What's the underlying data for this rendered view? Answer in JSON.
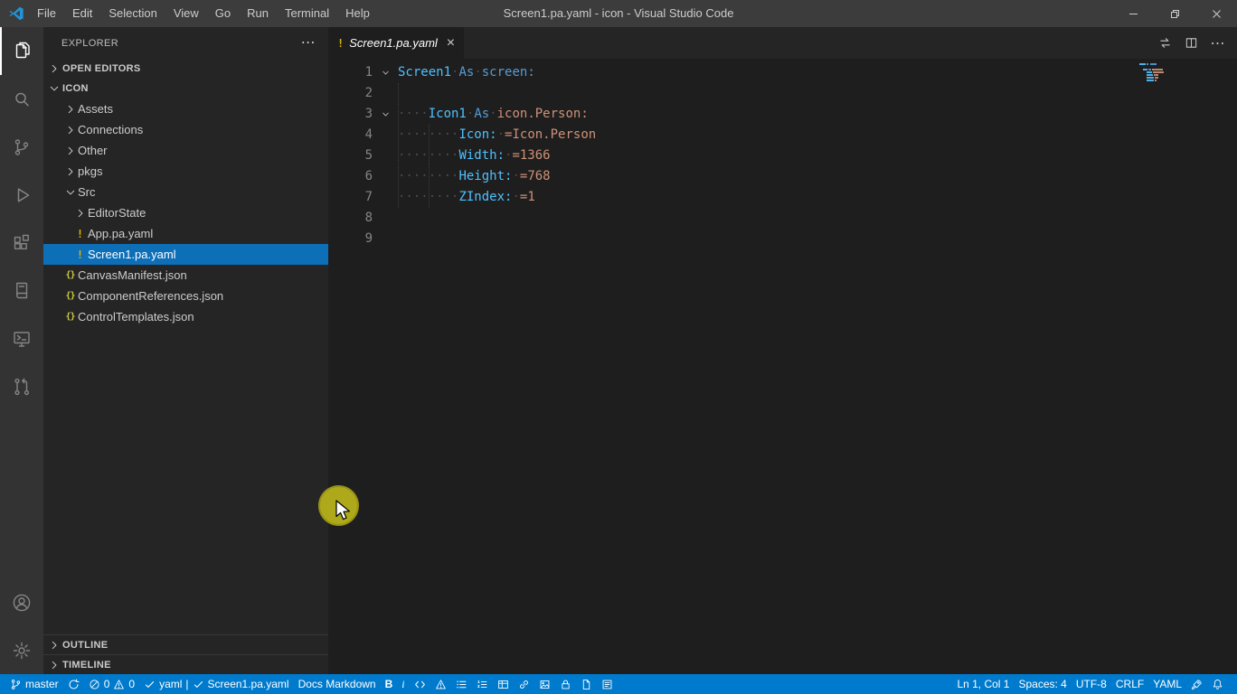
{
  "colors": {
    "accent": "#007acc",
    "titlebar": "#3c3c3c",
    "activitybar": "#333333",
    "sidebar": "#252526",
    "editor": "#1e1e1e",
    "selection": "#0d6fb8",
    "warn_icon": "#ddb100",
    "json_icon": "#cbcb41",
    "click_highlight": "#b6b01b",
    "syntax": {
      "name": "#4fc1ff",
      "keyword": "#569cd6",
      "property": "#4fc1ff",
      "value": "#ce9178",
      "whitespace": "#4a4a4a"
    }
  },
  "icons": {
    "more": "⋯",
    "close_tab": "×",
    "warn_file": "!",
    "json_file": "{}"
  },
  "title_bar": {
    "menus": [
      "File",
      "Edit",
      "Selection",
      "View",
      "Go",
      "Run",
      "Terminal",
      "Help"
    ],
    "title": "Screen1.pa.yaml - icon - Visual Studio Code"
  },
  "activity_bar": {
    "top": [
      {
        "id": "explorer",
        "active": true
      },
      {
        "id": "search"
      },
      {
        "id": "source-control"
      },
      {
        "id": "run-and-debug"
      },
      {
        "id": "extensions"
      },
      {
        "id": "docs"
      },
      {
        "id": "remote-explorer"
      },
      {
        "id": "github-pull-requests"
      }
    ],
    "bottom": [
      {
        "id": "accounts"
      },
      {
        "id": "manage"
      }
    ]
  },
  "sidebar": {
    "title": "EXPLORER",
    "open_editors_label": "OPEN EDITORS",
    "root_label": "ICON",
    "outline_label": "OUTLINE",
    "timeline_label": "TIMELINE",
    "tree": [
      {
        "label": "Assets",
        "indent": 1,
        "chevron": "right"
      },
      {
        "label": "Connections",
        "indent": 1,
        "chevron": "right"
      },
      {
        "label": "Other",
        "indent": 1,
        "chevron": "right"
      },
      {
        "label": "pkgs",
        "indent": 1,
        "chevron": "right"
      },
      {
        "label": "Src",
        "indent": 1,
        "chevron": "down"
      },
      {
        "label": "EditorState",
        "indent": 2,
        "chevron": "right"
      },
      {
        "label": "App.pa.yaml",
        "indent": 2,
        "icon": "warn"
      },
      {
        "label": "Screen1.pa.yaml",
        "indent": 2,
        "icon": "warn",
        "selected": true
      },
      {
        "label": "CanvasManifest.json",
        "indent": 1,
        "icon": "json"
      },
      {
        "label": "ComponentReferences.json",
        "indent": 1,
        "icon": "json"
      },
      {
        "label": "ControlTemplates.json",
        "indent": 1,
        "icon": "json"
      }
    ]
  },
  "editor": {
    "tab": {
      "label": "Screen1.pa.yaml"
    },
    "lines": [
      {
        "n": "1",
        "fold": "down",
        "tokens": [
          {
            "c": "name",
            "t": "Screen1"
          },
          {
            "c": "ws",
            "t": "·"
          },
          {
            "c": "kw",
            "t": "As"
          },
          {
            "c": "ws",
            "t": "·"
          },
          {
            "c": "kw",
            "t": "screen:"
          }
        ]
      },
      {
        "n": "2",
        "tokens": []
      },
      {
        "n": "3",
        "fold": "down",
        "tokens": [
          {
            "c": "ws",
            "t": "····"
          },
          {
            "c": "name",
            "t": "Icon1"
          },
          {
            "c": "ws",
            "t": "·"
          },
          {
            "c": "kw",
            "t": "As"
          },
          {
            "c": "ws",
            "t": "·"
          },
          {
            "c": "val",
            "t": "icon.Person:"
          }
        ]
      },
      {
        "n": "4",
        "tokens": [
          {
            "c": "ws",
            "t": "········"
          },
          {
            "c": "prop",
            "t": "Icon:"
          },
          {
            "c": "ws",
            "t": "·"
          },
          {
            "c": "val",
            "t": "=Icon.Person"
          }
        ]
      },
      {
        "n": "5",
        "tokens": [
          {
            "c": "ws",
            "t": "········"
          },
          {
            "c": "prop",
            "t": "Width:"
          },
          {
            "c": "ws",
            "t": "·"
          },
          {
            "c": "val",
            "t": "=1366"
          }
        ]
      },
      {
        "n": "6",
        "tokens": [
          {
            "c": "ws",
            "t": "········"
          },
          {
            "c": "prop",
            "t": "Height:"
          },
          {
            "c": "ws",
            "t": "·"
          },
          {
            "c": "val",
            "t": "=768"
          }
        ]
      },
      {
        "n": "7",
        "tokens": [
          {
            "c": "ws",
            "t": "········"
          },
          {
            "c": "prop",
            "t": "ZIndex:"
          },
          {
            "c": "ws",
            "t": "·"
          },
          {
            "c": "val",
            "t": "=1"
          }
        ]
      },
      {
        "n": "8",
        "tokens": []
      },
      {
        "n": "9",
        "tokens": []
      }
    ]
  },
  "status_bar": {
    "left": [
      {
        "name": "git-branch",
        "parts": [
          {
            "icon": "branch"
          },
          {
            "text": "master"
          }
        ]
      },
      {
        "name": "sync",
        "parts": [
          {
            "icon": "sync"
          }
        ]
      },
      {
        "name": "problems",
        "parts": [
          {
            "icon": "error"
          },
          {
            "text": "0"
          },
          {
            "icon": "warning"
          },
          {
            "text": "0"
          }
        ]
      },
      {
        "name": "lint-status",
        "parts": [
          {
            "icon": "check"
          },
          {
            "text": "yaml"
          },
          {
            "text": "|"
          },
          {
            "icon": "check"
          },
          {
            "text": "Screen1.pa.yaml"
          }
        ]
      },
      {
        "name": "docs-markdown",
        "parts": [
          {
            "text": "Docs Markdown"
          }
        ]
      },
      {
        "name": "bold",
        "parts": [
          {
            "text": "B"
          }
        ]
      },
      {
        "name": "italic",
        "parts": [
          {
            "text": "i"
          }
        ]
      },
      {
        "name": "code-snippet",
        "parts": [
          {
            "icon": "code"
          }
        ]
      },
      {
        "name": "alert",
        "parts": [
          {
            "icon": "warning"
          }
        ]
      },
      {
        "name": "bulleted-list",
        "parts": [
          {
            "icon": "list-ul"
          }
        ]
      },
      {
        "name": "numbered-list",
        "parts": [
          {
            "icon": "list-ol"
          }
        ]
      },
      {
        "name": "table",
        "parts": [
          {
            "icon": "table"
          }
        ]
      },
      {
        "name": "link",
        "parts": [
          {
            "icon": "link"
          }
        ]
      },
      {
        "name": "image",
        "parts": [
          {
            "icon": "image"
          }
        ]
      },
      {
        "name": "non-localizable",
        "parts": [
          {
            "icon": "lock"
          }
        ]
      },
      {
        "name": "docs-preview",
        "parts": [
          {
            "icon": "file"
          }
        ]
      },
      {
        "name": "template",
        "parts": [
          {
            "icon": "template"
          }
        ]
      }
    ],
    "right": [
      {
        "name": "cursor-position",
        "parts": [
          {
            "text": "Ln 1, Col 1"
          }
        ]
      },
      {
        "name": "indentation",
        "parts": [
          {
            "text": "Spaces: 4"
          }
        ]
      },
      {
        "name": "encoding",
        "parts": [
          {
            "text": "UTF-8"
          }
        ]
      },
      {
        "name": "end-of-line",
        "parts": [
          {
            "text": "CRLF"
          }
        ]
      },
      {
        "name": "language-mode",
        "parts": [
          {
            "text": "YAML"
          }
        ]
      },
      {
        "name": "feedback",
        "parts": [
          {
            "icon": "rocket"
          }
        ]
      },
      {
        "name": "notifications",
        "parts": [
          {
            "icon": "bell"
          }
        ]
      }
    ]
  }
}
